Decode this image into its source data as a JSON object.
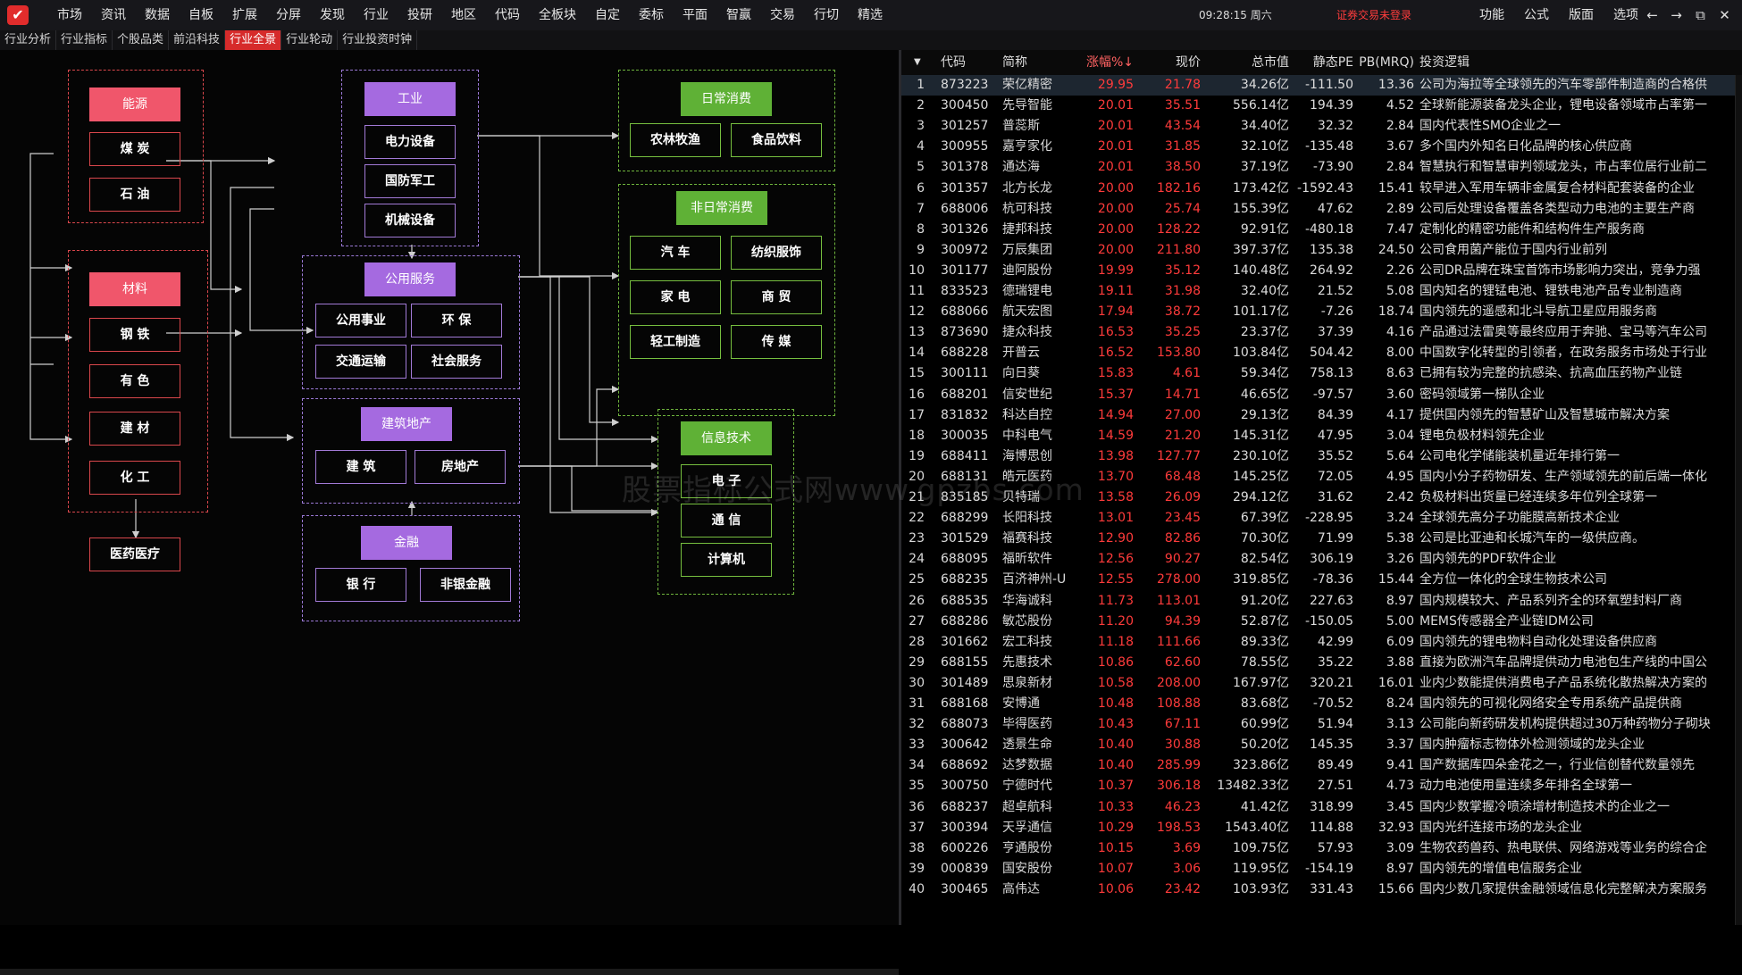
{
  "app": {
    "logo_glyph": "✔"
  },
  "menu": [
    "市场",
    "资讯",
    "数据",
    "自板",
    "扩展",
    "分屏",
    "发现",
    "行业",
    "投研",
    "地区",
    "代码",
    "全板块",
    "自定",
    "委标",
    "平面",
    "智赢",
    "交易",
    "行切",
    "精选"
  ],
  "clock": "09:28:15 周六",
  "status": "证券交易未登录",
  "right_menu": [
    "功能",
    "公式",
    "版面",
    "选项"
  ],
  "window_controls": [
    "←",
    "→",
    "⧉",
    "✕"
  ],
  "tabs": [
    "行业分析",
    "行业指标",
    "个股品类",
    "前沿科技",
    "行业全景",
    "行业轮动",
    "行业投资时钟"
  ],
  "active_tab": 4,
  "diagram": {
    "energy": {
      "title": "能源",
      "items": [
        "煤 炭",
        "石 油"
      ]
    },
    "materials": {
      "title": "材料",
      "items": [
        "钢 铁",
        "有 色",
        "建 材",
        "化 工"
      ]
    },
    "pharma": "医药医疗",
    "industry": {
      "title": "工业",
      "items": [
        "电力设备",
        "国防军工",
        "机械设备"
      ]
    },
    "public": {
      "title": "公用服务",
      "items": [
        "公用事业",
        "环 保",
        "交通运输",
        "社会服务"
      ]
    },
    "construction": {
      "title": "建筑地产",
      "items": [
        "建 筑",
        "房地产"
      ]
    },
    "finance": {
      "title": "金融",
      "items": [
        "银 行",
        "非银金融"
      ]
    },
    "daily": {
      "title": "日常消费",
      "items": [
        "农林牧渔",
        "食品饮料"
      ]
    },
    "nondaily": {
      "title": "非日常消费",
      "items": [
        "汽 车",
        "纺织服饰",
        "家 电",
        "商 贸",
        "轻工制造",
        "传 媒"
      ]
    },
    "it": {
      "title": "信息技术",
      "items": [
        "电 子",
        "通 信",
        "计算机"
      ]
    }
  },
  "table": {
    "sort_icon": "▼",
    "headers": {
      "code": "代码",
      "name": "简称",
      "chg": "涨幅%↓",
      "price": "现价",
      "cap": "总市值",
      "pe": "静态PE",
      "pb": "PB(MRQ)",
      "logic": "投资逻辑"
    },
    "rows": [
      {
        "idx": "1",
        "code": "873223",
        "name": "荣亿精密",
        "chg": "29.95",
        "price": "21.78",
        "cap": "34.26亿",
        "pe": "-111.50",
        "pb": "13.36",
        "logic": "公司为海拉等全球领先的汽车零部件制造商的合格供"
      },
      {
        "idx": "2",
        "code": "300450",
        "name": "先导智能",
        "chg": "20.01",
        "price": "35.51",
        "cap": "556.14亿",
        "pe": "194.39",
        "pb": "4.52",
        "logic": "全球新能源装备龙头企业，锂电设备领域市占率第一"
      },
      {
        "idx": "3",
        "code": "301257",
        "name": "普蕊斯",
        "chg": "20.01",
        "price": "43.54",
        "cap": "34.40亿",
        "pe": "32.32",
        "pb": "2.84",
        "logic": "国内代表性SMO企业之一"
      },
      {
        "idx": "4",
        "code": "300955",
        "name": "嘉亨家化",
        "chg": "20.01",
        "price": "31.85",
        "cap": "32.10亿",
        "pe": "-135.48",
        "pb": "3.67",
        "logic": "多个国内外知名日化品牌的核心供应商"
      },
      {
        "idx": "5",
        "code": "301378",
        "name": "通达海",
        "chg": "20.01",
        "price": "38.50",
        "cap": "37.19亿",
        "pe": "-73.90",
        "pb": "2.84",
        "logic": "智慧执行和智慧审判领域龙头，市占率位居行业前二"
      },
      {
        "idx": "6",
        "code": "301357",
        "name": "北方长龙",
        "chg": "20.00",
        "price": "182.16",
        "cap": "173.42亿",
        "pe": "-1592.43",
        "pb": "15.41",
        "logic": "较早进入军用车辆非金属复合材料配套装备的企业"
      },
      {
        "idx": "7",
        "code": "688006",
        "name": "杭可科技",
        "chg": "20.00",
        "price": "25.74",
        "cap": "155.39亿",
        "pe": "47.62",
        "pb": "2.89",
        "logic": "公司后处理设备覆盖各类型动力电池的主要生产商"
      },
      {
        "idx": "8",
        "code": "301326",
        "name": "捷邦科技",
        "chg": "20.00",
        "price": "128.22",
        "cap": "92.91亿",
        "pe": "-480.18",
        "pb": "7.47",
        "logic": "定制化的精密功能件和结构件生产服务商"
      },
      {
        "idx": "9",
        "code": "300972",
        "name": "万辰集团",
        "chg": "20.00",
        "price": "211.80",
        "cap": "397.37亿",
        "pe": "135.38",
        "pb": "24.50",
        "logic": "公司食用菌产能位于国内行业前列"
      },
      {
        "idx": "10",
        "code": "301177",
        "name": "迪阿股份",
        "chg": "19.99",
        "price": "35.12",
        "cap": "140.48亿",
        "pe": "264.92",
        "pb": "2.26",
        "logic": "公司DR品牌在珠宝首饰市场影响力突出，竞争力强"
      },
      {
        "idx": "11",
        "code": "833523",
        "name": "德瑞锂电",
        "chg": "19.11",
        "price": "31.98",
        "cap": "32.40亿",
        "pe": "21.52",
        "pb": "5.08",
        "logic": "国内知名的锂锰电池、锂铁电池产品专业制造商"
      },
      {
        "idx": "12",
        "code": "688066",
        "name": "航天宏图",
        "chg": "17.94",
        "price": "38.72",
        "cap": "101.17亿",
        "pe": "-7.26",
        "pb": "18.74",
        "logic": "国内领先的遥感和北斗导航卫星应用服务商"
      },
      {
        "idx": "13",
        "code": "873690",
        "name": "捷众科技",
        "chg": "16.53",
        "price": "35.25",
        "cap": "23.37亿",
        "pe": "37.39",
        "pb": "4.16",
        "logic": "产品通过法雷奥等最终应用于奔驰、宝马等汽车公司"
      },
      {
        "idx": "14",
        "code": "688228",
        "name": "开普云",
        "chg": "16.52",
        "price": "153.80",
        "cap": "103.84亿",
        "pe": "504.42",
        "pb": "8.00",
        "logic": "中国数字化转型的引领者，在政务服务市场处于行业"
      },
      {
        "idx": "15",
        "code": "300111",
        "name": "向日葵",
        "chg": "15.83",
        "price": "4.61",
        "cap": "59.34亿",
        "pe": "758.13",
        "pb": "8.63",
        "logic": "已拥有较为完整的抗感染、抗高血压药物产业链"
      },
      {
        "idx": "16",
        "code": "688201",
        "name": "信安世纪",
        "chg": "15.37",
        "price": "14.71",
        "cap": "46.65亿",
        "pe": "-97.57",
        "pb": "3.60",
        "logic": "密码领域第一梯队企业"
      },
      {
        "idx": "17",
        "code": "831832",
        "name": "科达自控",
        "chg": "14.94",
        "price": "27.00",
        "cap": "29.13亿",
        "pe": "84.39",
        "pb": "4.17",
        "logic": "提供国内领先的智慧矿山及智慧城市解决方案"
      },
      {
        "idx": "18",
        "code": "300035",
        "name": "中科电气",
        "chg": "14.59",
        "price": "21.20",
        "cap": "145.31亿",
        "pe": "47.95",
        "pb": "3.04",
        "logic": "锂电负极材料领先企业"
      },
      {
        "idx": "19",
        "code": "688411",
        "name": "海博思创",
        "chg": "13.98",
        "price": "127.77",
        "cap": "230.10亿",
        "pe": "35.52",
        "pb": "5.64",
        "logic": "公司电化学储能装机量近年排行第一"
      },
      {
        "idx": "20",
        "code": "688131",
        "name": "皓元医药",
        "chg": "13.70",
        "price": "68.48",
        "cap": "145.25亿",
        "pe": "72.05",
        "pb": "4.95",
        "logic": "国内小分子药物研发、生产领域领先的前后端一体化"
      },
      {
        "idx": "21",
        "code": "835185",
        "name": "贝特瑞",
        "chg": "13.58",
        "price": "26.09",
        "cap": "294.12亿",
        "pe": "31.62",
        "pb": "2.42",
        "logic": "负极材料出货量已经连续多年位列全球第一"
      },
      {
        "idx": "22",
        "code": "688299",
        "name": "长阳科技",
        "chg": "13.01",
        "price": "23.45",
        "cap": "67.39亿",
        "pe": "-228.95",
        "pb": "3.24",
        "logic": "全球领先高分子功能膜高新技术企业"
      },
      {
        "idx": "23",
        "code": "301529",
        "name": "福赛科技",
        "chg": "12.90",
        "price": "82.86",
        "cap": "70.30亿",
        "pe": "71.99",
        "pb": "5.38",
        "logic": "公司是比亚迪和长城汽车的一级供应商。"
      },
      {
        "idx": "24",
        "code": "688095",
        "name": "福昕软件",
        "chg": "12.56",
        "price": "90.27",
        "cap": "82.54亿",
        "pe": "306.19",
        "pb": "3.26",
        "logic": "国内领先的PDF软件企业"
      },
      {
        "idx": "25",
        "code": "688235",
        "name": "百济神州-U",
        "chg": "12.55",
        "price": "278.00",
        "cap": "319.85亿",
        "pe": "-78.36",
        "pb": "15.44",
        "logic": "全方位一体化的全球生物技术公司"
      },
      {
        "idx": "26",
        "code": "688535",
        "name": "华海诚科",
        "chg": "11.73",
        "price": "113.01",
        "cap": "91.20亿",
        "pe": "227.63",
        "pb": "8.97",
        "logic": "国内规模较大、产品系列齐全的环氧塑封料厂商"
      },
      {
        "idx": "27",
        "code": "688286",
        "name": "敏芯股份",
        "chg": "11.20",
        "price": "94.39",
        "cap": "52.87亿",
        "pe": "-150.05",
        "pb": "5.00",
        "logic": "MEMS传感器全产业链IDM公司"
      },
      {
        "idx": "28",
        "code": "301662",
        "name": "宏工科技",
        "chg": "11.18",
        "price": "111.66",
        "cap": "89.33亿",
        "pe": "42.99",
        "pb": "6.09",
        "logic": "国内领先的锂电物料自动化处理设备供应商"
      },
      {
        "idx": "29",
        "code": "688155",
        "name": "先惠技术",
        "chg": "10.86",
        "price": "62.60",
        "cap": "78.55亿",
        "pe": "35.22",
        "pb": "3.88",
        "logic": "直接为欧洲汽车品牌提供动力电池包生产线的中国公"
      },
      {
        "idx": "30",
        "code": "301489",
        "name": "思泉新材",
        "chg": "10.58",
        "price": "208.00",
        "cap": "167.97亿",
        "pe": "320.21",
        "pb": "16.01",
        "logic": "业内少数能提供消费电子产品系统化散热解决方案的"
      },
      {
        "idx": "31",
        "code": "688168",
        "name": "安博通",
        "chg": "10.48",
        "price": "108.88",
        "cap": "83.68亿",
        "pe": "-70.52",
        "pb": "8.24",
        "logic": "国内领先的可视化网络安全专用系统产品提供商"
      },
      {
        "idx": "32",
        "code": "688073",
        "name": "毕得医药",
        "chg": "10.43",
        "price": "67.11",
        "cap": "60.99亿",
        "pe": "51.94",
        "pb": "3.13",
        "logic": "公司能向新药研发机构提供超过30万种药物分子砌块"
      },
      {
        "idx": "33",
        "code": "300642",
        "name": "透景生命",
        "chg": "10.40",
        "price": "30.88",
        "cap": "50.20亿",
        "pe": "145.35",
        "pb": "3.37",
        "logic": "国内肿瘤标志物体外检测领域的龙头企业"
      },
      {
        "idx": "34",
        "code": "688692",
        "name": "达梦数据",
        "chg": "10.40",
        "price": "285.99",
        "cap": "323.86亿",
        "pe": "89.49",
        "pb": "9.41",
        "logic": "国产数据库四朵金花之一，行业信创替代数量领先"
      },
      {
        "idx": "35",
        "code": "300750",
        "name": "宁德时代",
        "chg": "10.37",
        "price": "306.18",
        "cap": "13482.33亿",
        "pe": "27.51",
        "pb": "4.73",
        "logic": "动力电池使用量连续多年排名全球第一"
      },
      {
        "idx": "36",
        "code": "688237",
        "name": "超卓航科",
        "chg": "10.33",
        "price": "46.23",
        "cap": "41.42亿",
        "pe": "318.99",
        "pb": "3.45",
        "logic": "国内少数掌握冷喷涂增材制造技术的企业之一"
      },
      {
        "idx": "37",
        "code": "300394",
        "name": "天孚通信",
        "chg": "10.29",
        "price": "198.53",
        "cap": "1543.40亿",
        "pe": "114.88",
        "pb": "32.93",
        "logic": "国内光纤连接市场的龙头企业"
      },
      {
        "idx": "38",
        "code": "600226",
        "name": "亨通股份",
        "chg": "10.15",
        "price": "3.69",
        "cap": "109.75亿",
        "pe": "57.93",
        "pb": "3.09",
        "logic": "生物农药兽药、热电联供、网络游戏等业务的综合企"
      },
      {
        "idx": "39",
        "code": "000839",
        "name": "国安股份",
        "chg": "10.07",
        "price": "3.06",
        "cap": "119.95亿",
        "pe": "-154.19",
        "pb": "8.97",
        "logic": "国内领先的增值电信服务企业"
      },
      {
        "idx": "40",
        "code": "300465",
        "name": "高伟达",
        "chg": "10.06",
        "price": "23.42",
        "cap": "103.93亿",
        "pe": "331.43",
        "pb": "15.66",
        "logic": "国内少数几家提供金融领域信息化完整解决方案服务"
      }
    ]
  },
  "watermark": "股票指标公式网www.gpzbs.com"
}
